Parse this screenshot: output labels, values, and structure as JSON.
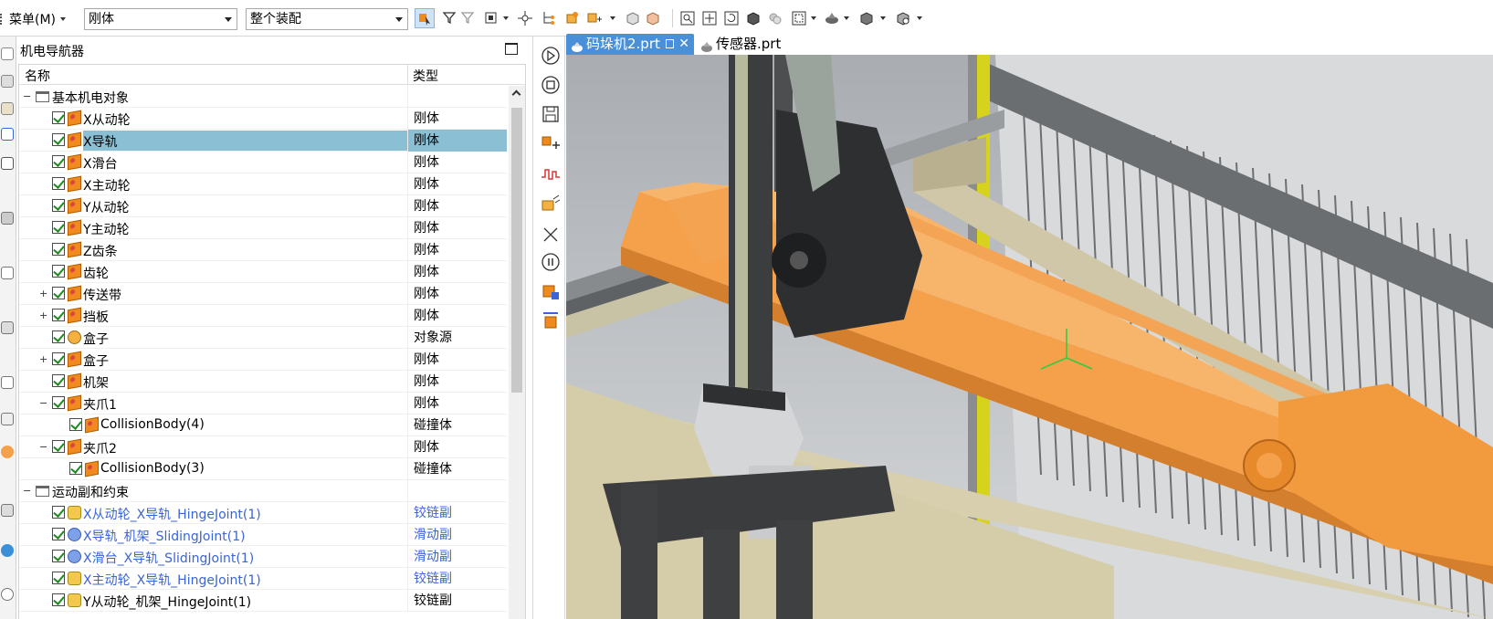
{
  "toolbar": {
    "menu_label": "菜单(M)",
    "filter_value": "刚体",
    "scope_value": "整个装配"
  },
  "navigator": {
    "title": "机电导航器",
    "columns": {
      "name": "名称",
      "type": "类型"
    },
    "rows": [
      {
        "label": "基本机电对象",
        "type": "",
        "kind": "folder"
      },
      {
        "label": "X从动轮",
        "type": "刚体",
        "kind": "body"
      },
      {
        "label": "X导轨",
        "type": "刚体",
        "kind": "body",
        "selected": true
      },
      {
        "label": "X滑台",
        "type": "刚体",
        "kind": "body"
      },
      {
        "label": "X主动轮",
        "type": "刚体",
        "kind": "body"
      },
      {
        "label": "Y从动轮",
        "type": "刚体",
        "kind": "body"
      },
      {
        "label": "Y主动轮",
        "type": "刚体",
        "kind": "body"
      },
      {
        "label": "Z齿条",
        "type": "刚体",
        "kind": "body"
      },
      {
        "label": "齿轮",
        "type": "刚体",
        "kind": "body"
      },
      {
        "label": "传送带",
        "type": "刚体",
        "kind": "body"
      },
      {
        "label": "挡板",
        "type": "刚体",
        "kind": "body"
      },
      {
        "label": "盒子",
        "type": "对象源",
        "kind": "source"
      },
      {
        "label": "盒子",
        "type": "刚体",
        "kind": "body"
      },
      {
        "label": "机架",
        "type": "刚体",
        "kind": "body"
      },
      {
        "label": "夹爪1",
        "type": "刚体",
        "kind": "body"
      },
      {
        "label": "CollisionBody(4)",
        "type": "碰撞体",
        "kind": "collision"
      },
      {
        "label": "夹爪2",
        "type": "刚体",
        "kind": "body"
      },
      {
        "label": "CollisionBody(3)",
        "type": "碰撞体",
        "kind": "collision"
      },
      {
        "label": "运动副和约束",
        "type": "",
        "kind": "folder"
      },
      {
        "label": "X从动轮_X导轨_HingeJoint(1)",
        "type": "铰链副",
        "kind": "hinge",
        "blue": true
      },
      {
        "label": "X导轨_机架_SlidingJoint(1)",
        "type": "滑动副",
        "kind": "slide",
        "blue": true
      },
      {
        "label": "X滑台_X导轨_SlidingJoint(1)",
        "type": "滑动副",
        "kind": "slide",
        "blue": true
      },
      {
        "label": "X主动轮_X导轨_HingeJoint(1)",
        "type": "铰链副",
        "kind": "hinge",
        "blue": true
      },
      {
        "label": "Y从动轮_机架_HingeJoint(1)",
        "type": "铰链副",
        "kind": "hinge"
      }
    ]
  },
  "tabs": [
    {
      "label": "码垛机2.prt",
      "active": true
    },
    {
      "label": "传感器.prt",
      "active": false
    }
  ],
  "colors": {
    "selection": "#8bbfd3",
    "tab_active": "#4a90d9",
    "joint_text": "#3a64d8",
    "part_orange": "#f5a04a"
  }
}
